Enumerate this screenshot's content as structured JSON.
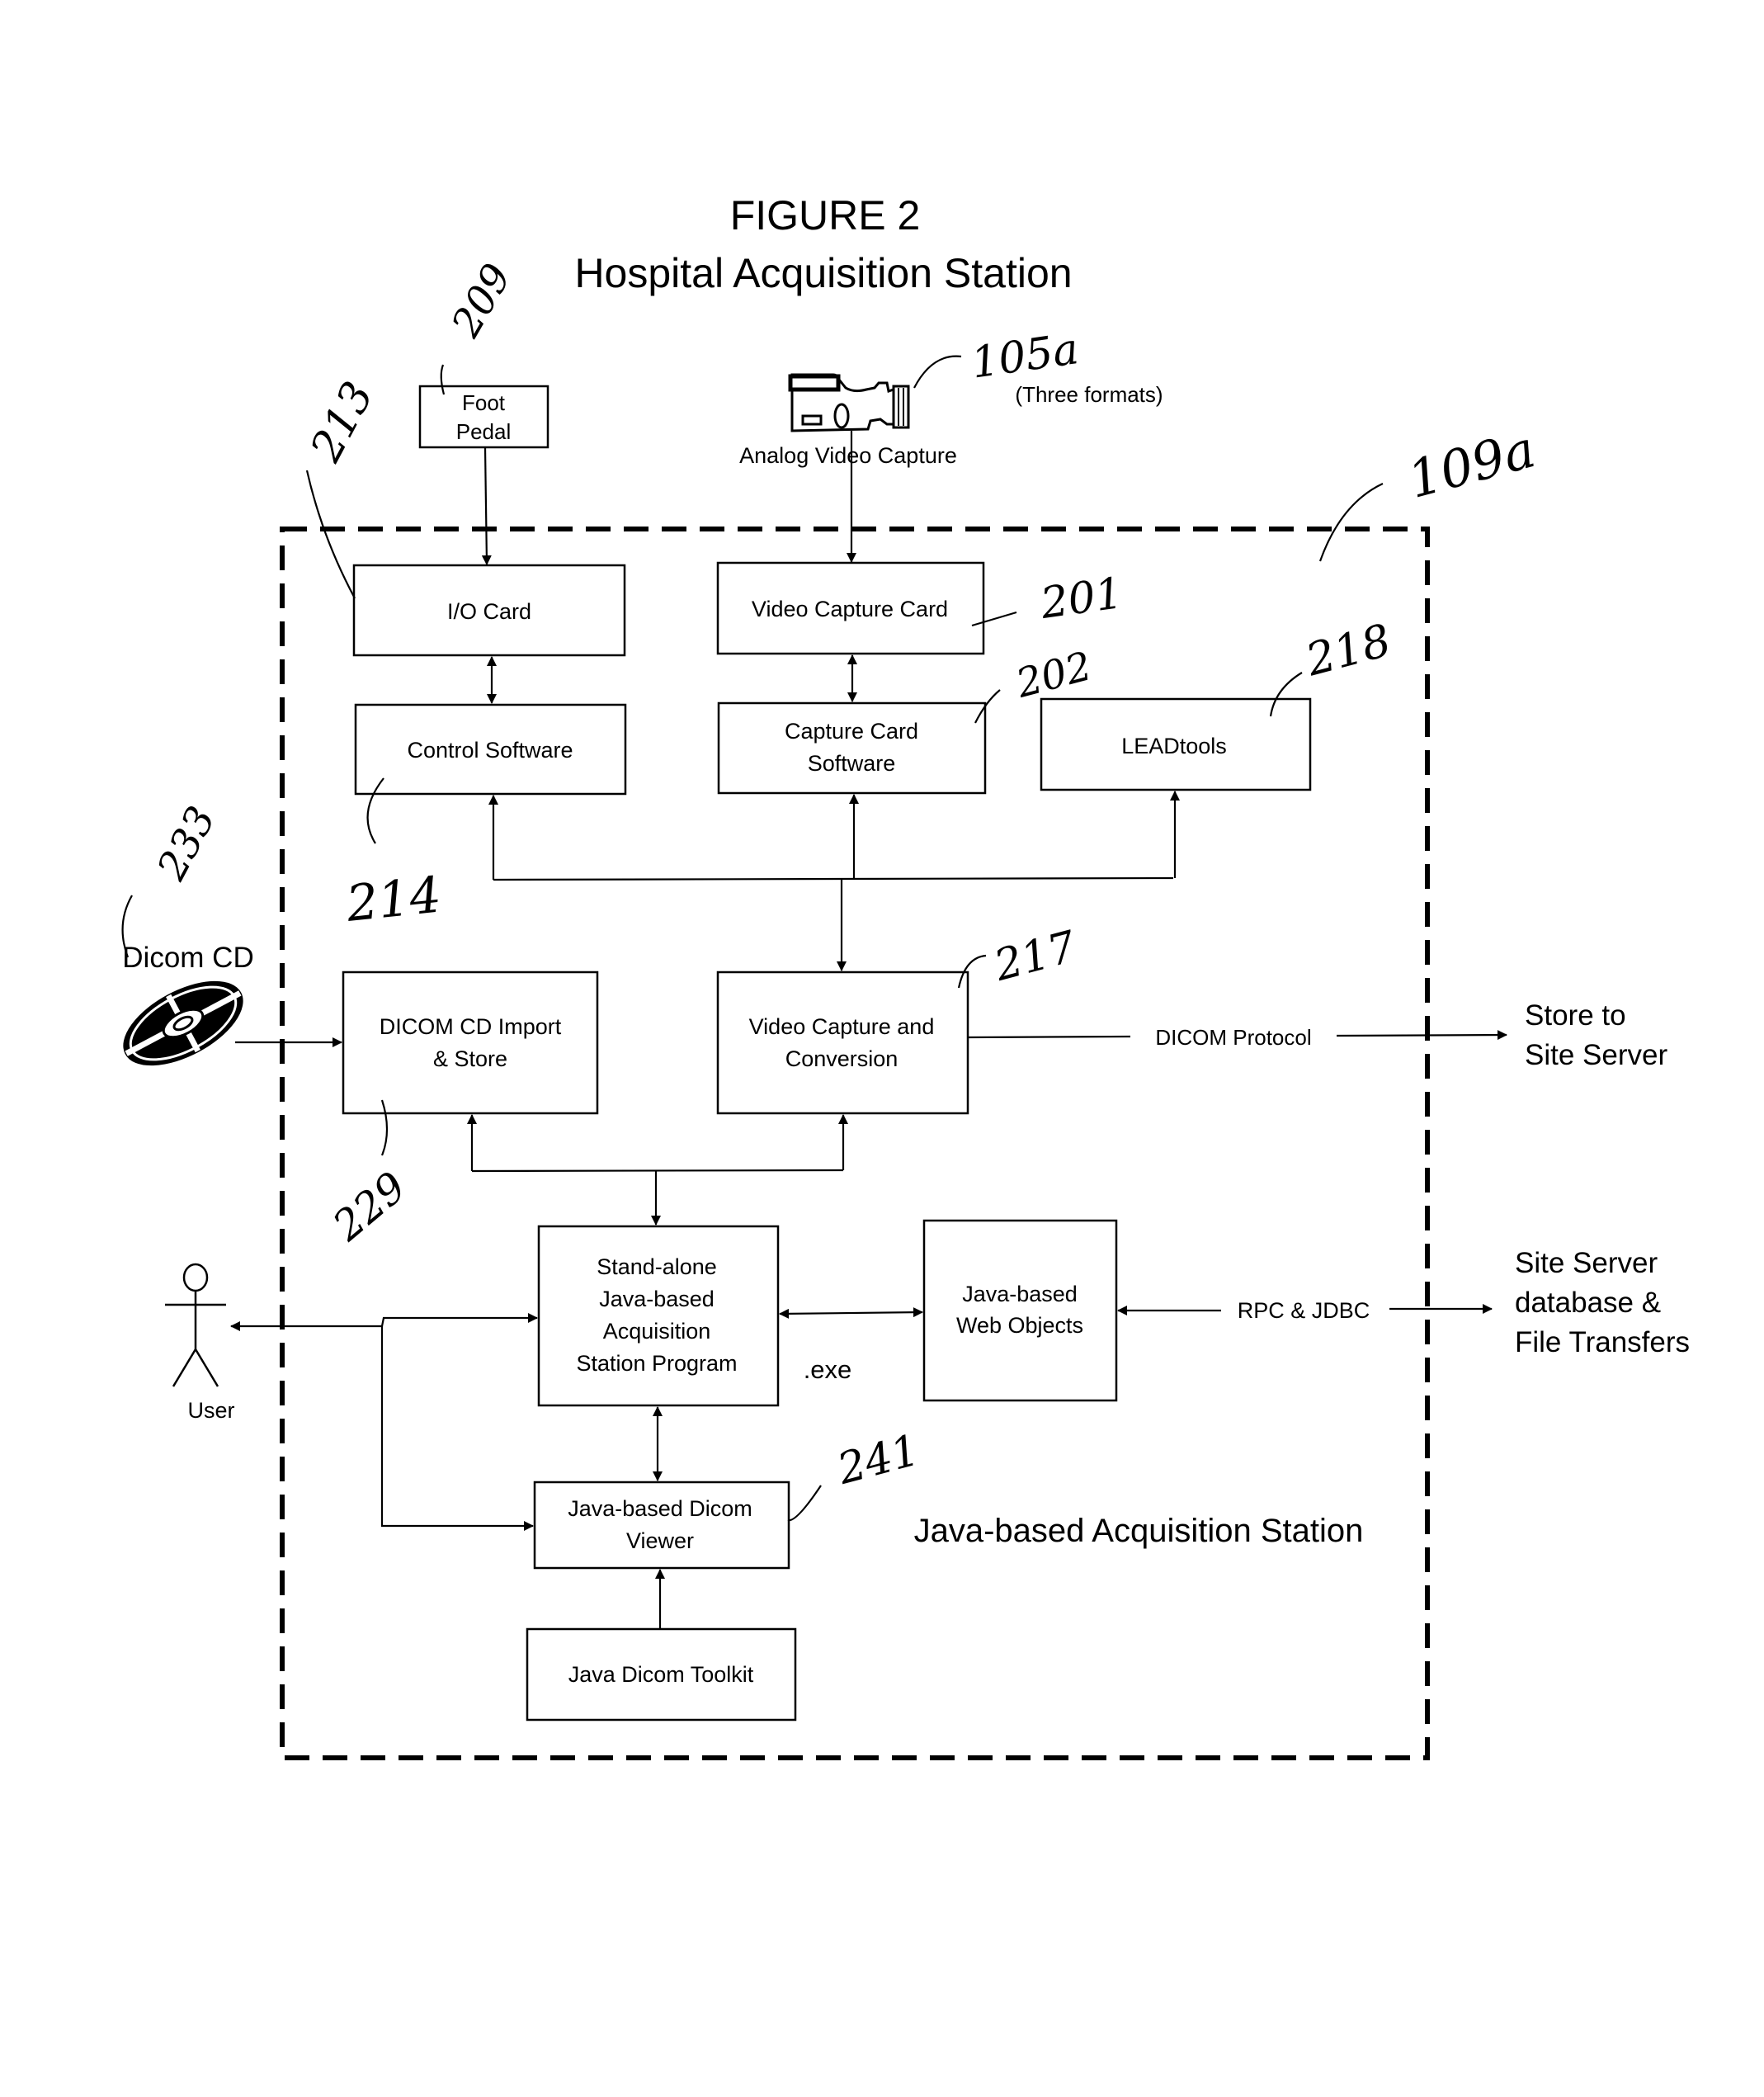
{
  "figure": {
    "number_label": "FIGURE 2",
    "title": "Hospital Acquisition Station",
    "boundary_label": "Java-based Acquisition Station"
  },
  "external": {
    "foot_pedal": [
      "Foot",
      "Pedal"
    ],
    "camera_label": "Analog Video Capture",
    "camera_note": "(Three formats)",
    "dicom_cd_label": "Dicom CD",
    "user_label": "User",
    "store_target": [
      "Store to",
      "Site Server"
    ],
    "site_server_target": [
      "Site Server",
      "database &",
      "File Transfers"
    ]
  },
  "boxes": {
    "io_card": [
      "I/O Card"
    ],
    "video_capture_card": [
      "Video Capture Card"
    ],
    "control_software": [
      "Control Software"
    ],
    "capture_card_software": [
      "Capture Card",
      "Software"
    ],
    "leadtools": [
      "LEADtools"
    ],
    "dicom_cd_import": [
      "DICOM CD Import",
      "& Store"
    ],
    "video_capture_conversion": [
      "Video Capture and",
      "Conversion"
    ],
    "standalone_program": [
      "Stand-alone",
      "Java-based",
      "Acquisition",
      "Station Program"
    ],
    "web_objects": [
      "Java-based",
      "Web Objects"
    ],
    "dicom_viewer": [
      "Java-based Dicom",
      "Viewer"
    ],
    "dicom_toolkit": [
      "Java Dicom Toolkit"
    ]
  },
  "connectors": {
    "dicom_protocol": "DICOM Protocol",
    "rpc_jdbc": "RPC & JDBC",
    "exe": ".exe"
  },
  "reference_numerals": {
    "foot_pedal": "209",
    "io_card": "213",
    "camera": "105a",
    "station": "109a",
    "video_capture_card": "201",
    "capture_card_software": "202",
    "leadtools": "218",
    "control_software": "214",
    "dicom_cd": "233",
    "video_capture_conversion": "217",
    "dicom_cd_import": "229",
    "dicom_viewer": "241"
  }
}
